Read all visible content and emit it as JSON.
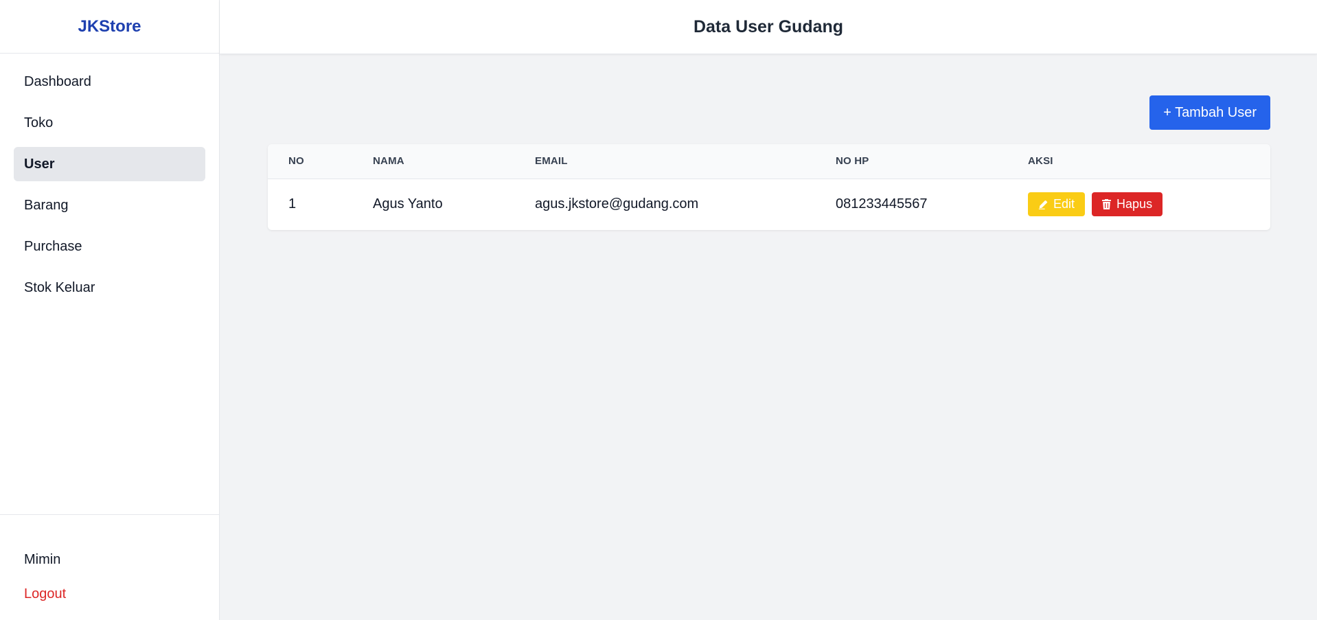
{
  "app": {
    "brand": "JKStore",
    "page_title": "Data User Gudang"
  },
  "sidebar": {
    "items": [
      {
        "label": "Dashboard"
      },
      {
        "label": "Toko"
      },
      {
        "label": "User"
      },
      {
        "label": "Barang"
      },
      {
        "label": "Purchase"
      },
      {
        "label": "Stok Keluar"
      }
    ],
    "active": "User",
    "footer": {
      "username": "Mimin",
      "logout_label": "Logout"
    }
  },
  "toolbar": {
    "add_label": "+ Tambah User"
  },
  "table": {
    "columns": [
      "NO",
      "NAMA",
      "EMAIL",
      "NO HP",
      "AKSI"
    ],
    "rows": [
      {
        "no": "1",
        "nama": "Agus Yanto",
        "email": "agus.jkstore@gudang.com",
        "hp": "081233445567"
      }
    ],
    "actions": {
      "edit_label": "Edit",
      "delete_label": "Hapus"
    }
  },
  "colors": {
    "brand": "#1e40af",
    "primary": "#2563eb",
    "edit": "#facc15",
    "danger": "#dc2626"
  },
  "icons": {
    "edit": "pencil-icon",
    "delete": "trash-icon"
  }
}
